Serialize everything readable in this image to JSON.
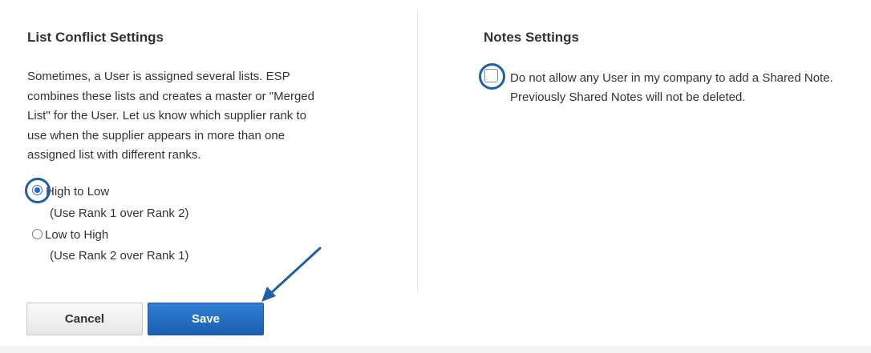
{
  "list_conflict": {
    "title": "List Conflict Settings",
    "description_lines": [
      "Sometimes, a User is assigned several lists. ESP",
      "combines these lists and creates a master or \"Merged",
      "List\" for the User. Let us know which supplier rank to",
      "use when the supplier appears in more than one",
      "assigned list with different ranks."
    ],
    "options": [
      {
        "label": "High to Low",
        "sublabel": "(Use Rank 1 over Rank 2)",
        "selected": true
      },
      {
        "label": "Low to High",
        "sublabel": "(Use Rank 2 over Rank 1)",
        "selected": false
      }
    ]
  },
  "notes": {
    "title": "Notes Settings",
    "checkbox_checked": false,
    "checkbox_lines": [
      "Do not allow any User in my company to add a Shared Note.",
      "Previously Shared Notes will not be deleted."
    ]
  },
  "actions": {
    "cancel_label": "Cancel",
    "save_label": "Save"
  },
  "colors": {
    "save_button": "#1f6cc4",
    "annotation": "#1f5fa8",
    "radio_selected": "#1e66e0"
  },
  "annotations": {
    "highlight_icon": "circle-highlight",
    "pointer_icon": "arrow-pointer"
  }
}
